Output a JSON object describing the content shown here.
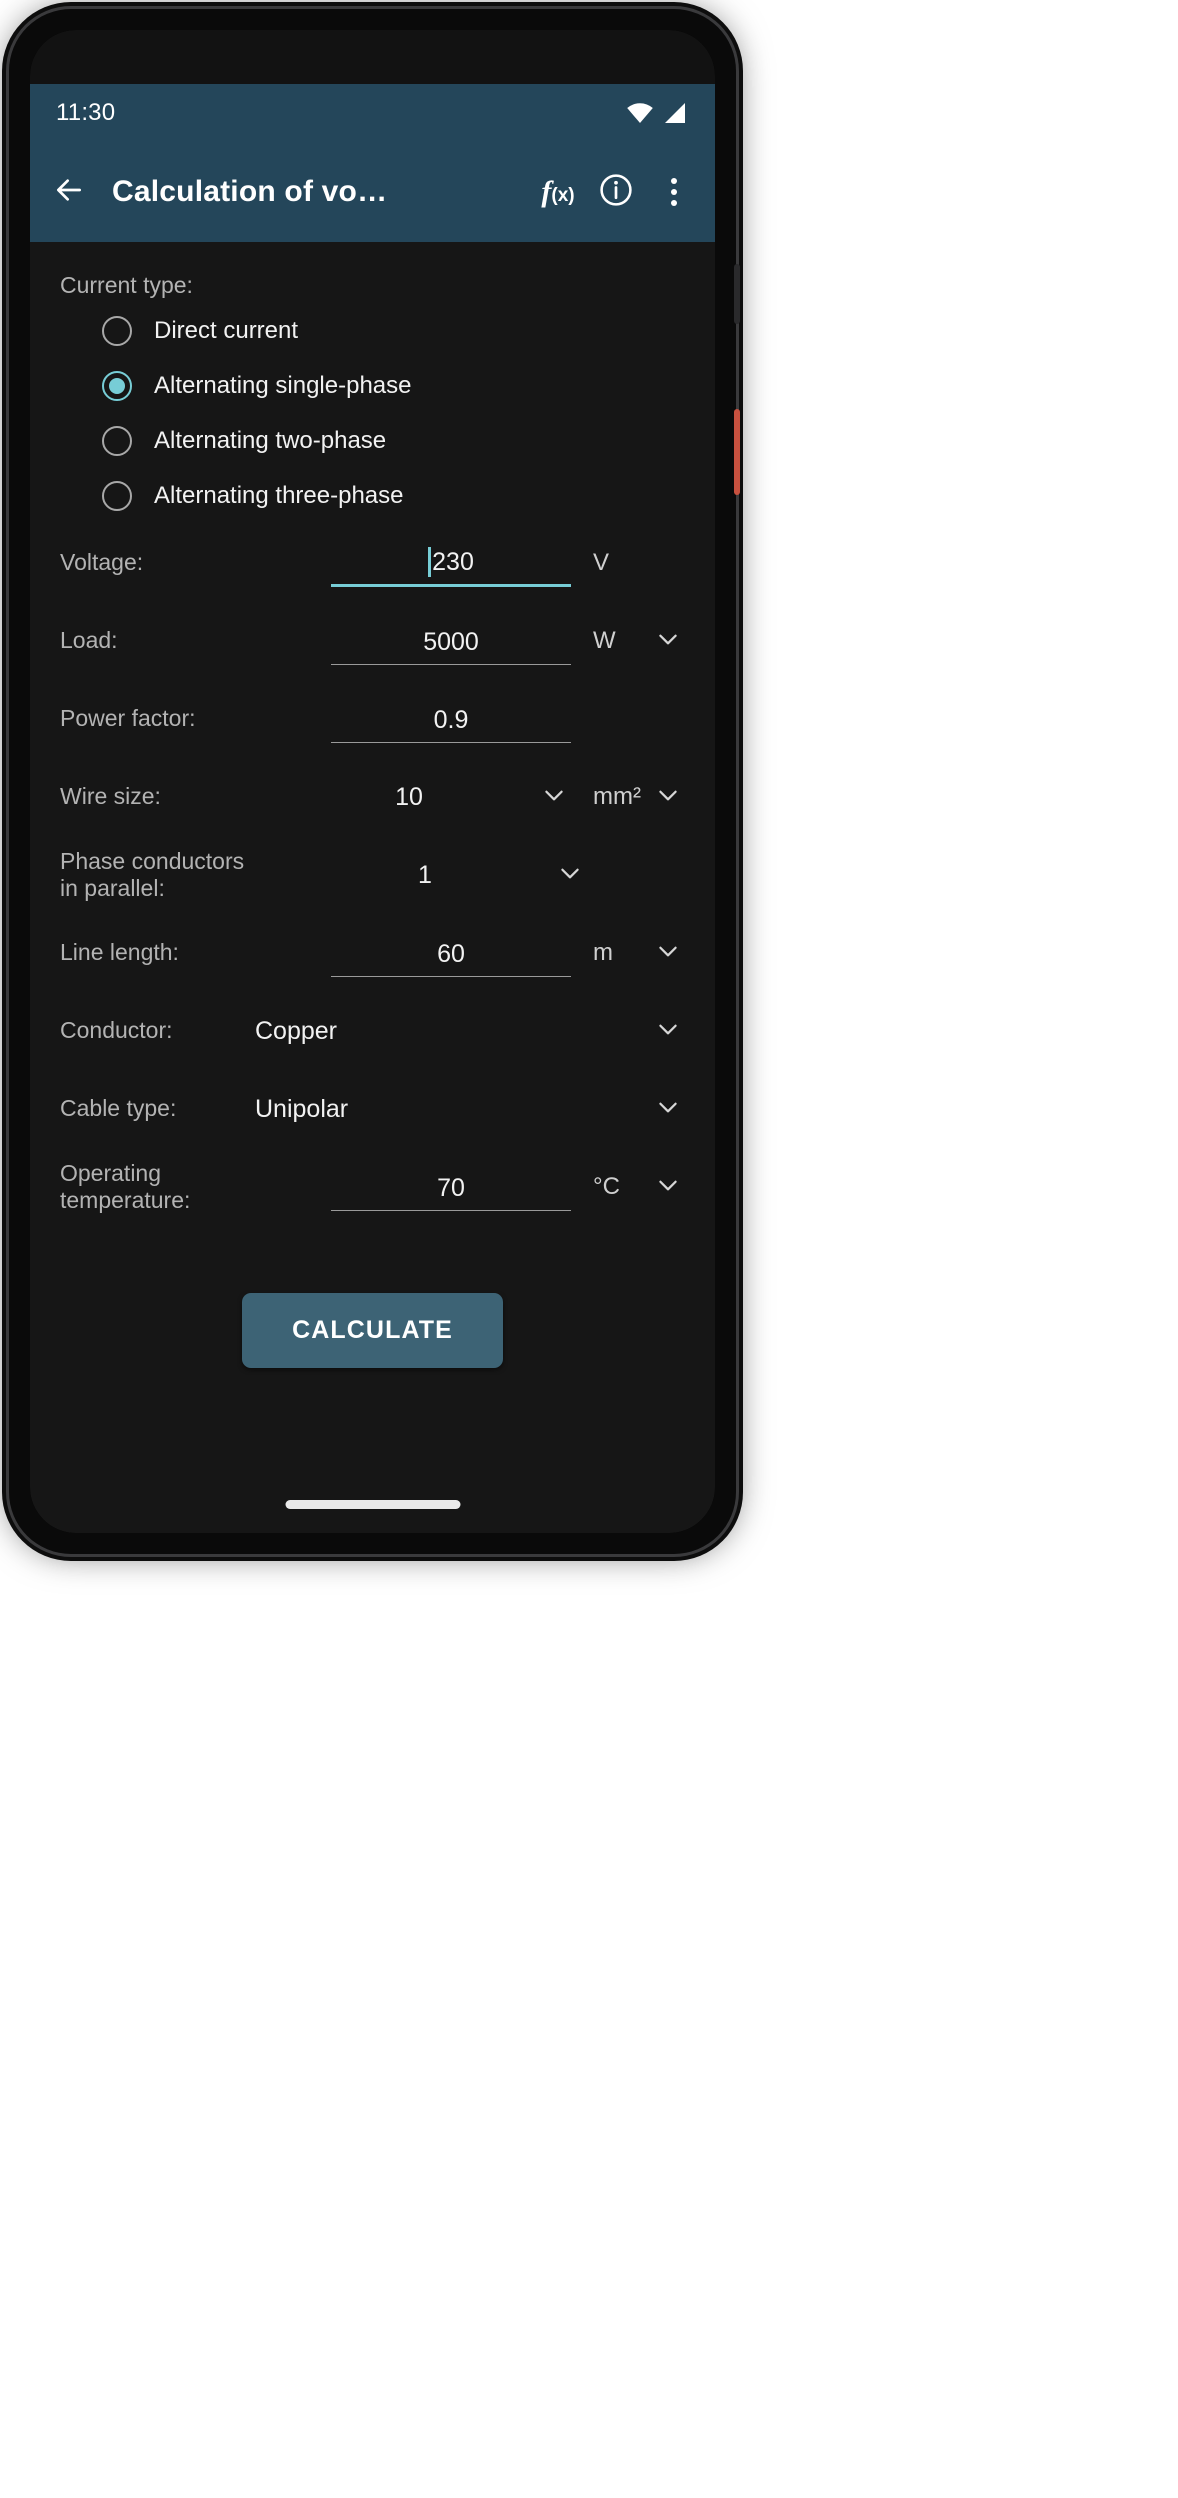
{
  "status_bar": {
    "time": "11:30",
    "icons": [
      "wifi-icon",
      "cellular-signal-icon"
    ]
  },
  "app_bar": {
    "back_icon": "back-arrow-icon",
    "title": "Calculation of vo…",
    "function_button_label": "f",
    "function_button_sub": "(x)",
    "info_icon": "info-icon",
    "overflow_icon": "overflow-menu-icon"
  },
  "colors": {
    "appbar_bg": "#24465a",
    "screen_bg": "#161616",
    "accent": "#77cdd6",
    "button_bg": "#3d6375",
    "label_text": "#b3b3b3",
    "value_text": "#f2f2f2"
  },
  "form": {
    "current_type": {
      "label": "Current type:",
      "options": [
        {
          "label": "Direct current",
          "selected": false
        },
        {
          "label": "Alternating single-phase",
          "selected": true
        },
        {
          "label": "Alternating two-phase",
          "selected": false
        },
        {
          "label": "Alternating three-phase",
          "selected": false
        }
      ]
    },
    "voltage": {
      "label": "Voltage:",
      "value": "230",
      "unit": "V",
      "focused": true,
      "has_caret": true
    },
    "load": {
      "label": "Load:",
      "value": "5000",
      "unit": "W",
      "has_unit_dropdown": true
    },
    "power_factor": {
      "label": "Power factor:",
      "value": "0.9",
      "unit": ""
    },
    "wire_size": {
      "label": "Wire size:",
      "value": "10",
      "unit": "mm²",
      "has_value_dropdown": true,
      "has_unit_dropdown": true
    },
    "parallel_conductors": {
      "label": "Phase conductors in parallel:",
      "value": "1",
      "has_value_dropdown": true
    },
    "line_length": {
      "label": "Line length:",
      "value": "60",
      "unit": "m",
      "has_unit_dropdown": true
    },
    "conductor": {
      "label": "Conductor:",
      "value": "Copper",
      "has_value_dropdown": true
    },
    "cable_type": {
      "label": "Cable type:",
      "value": "Unipolar",
      "has_value_dropdown": true
    },
    "operating_temperature": {
      "label": "Operating temperature:",
      "value": "70",
      "unit": "°C",
      "has_unit_dropdown": true
    }
  },
  "actions": {
    "calculate_label": "CALCULATE"
  }
}
